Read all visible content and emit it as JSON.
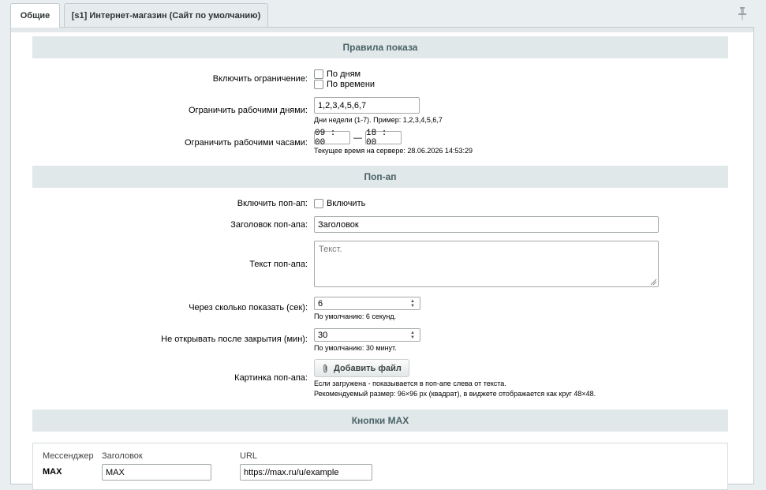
{
  "tabs": [
    {
      "label": "Общие"
    },
    {
      "label": "[s1] Интернет-магазин (Сайт по умолчанию)"
    }
  ],
  "sections": {
    "display_rules": {
      "title": "Правила показа",
      "enable_limit_label": "Включить ограничение:",
      "by_days_label": "По дням",
      "by_time_label": "По времени",
      "workdays_label": "Ограничить рабочими днями:",
      "workdays_value": "1,2,3,4,5,6,7",
      "workdays_hint": "Дни недели (1-7). Пример: 1,2,3,4,5,6,7",
      "workhours_label": "Ограничить рабочими часами:",
      "time_from": "09 : 00",
      "time_separator": "—",
      "time_to": "18 : 00",
      "server_time_hint": "Текущее время на сервере: 28.06.2026 14:53:29"
    },
    "popup": {
      "title": "Поп-ап",
      "enable_label": "Включить поп-ап:",
      "enable_checkbox_label": "Включить",
      "heading_label": "Заголовок поп-апа:",
      "heading_value": "Заголовок",
      "text_label": "Текст поп-апа:",
      "text_placeholder": "Текст.",
      "delay_label": "Через сколько показать (сек):",
      "delay_value": "6",
      "delay_hint": "По умолчанию: 6 секунд.",
      "reopen_label": "Не открывать после закрытия (мин):",
      "reopen_value": "30",
      "reopen_hint": "По умолчанию: 30 минут.",
      "image_label": "Картинка поп-апа:",
      "add_file_label": "Добавить файл",
      "image_hint_1": "Если загружена - показывается в поп-апе слева от текста.",
      "image_hint_2": "Рекомендуемый размер: 96×96 px (квадрат), в виджете отображается как круг 48×48."
    },
    "max_buttons": {
      "title": "Кнопки MAX",
      "columns": [
        "Мессенджер",
        "Заголовок",
        "URL"
      ],
      "row": {
        "messenger": "MAX",
        "heading": "MAX",
        "url": "https://max.ru/u/example"
      }
    }
  }
}
